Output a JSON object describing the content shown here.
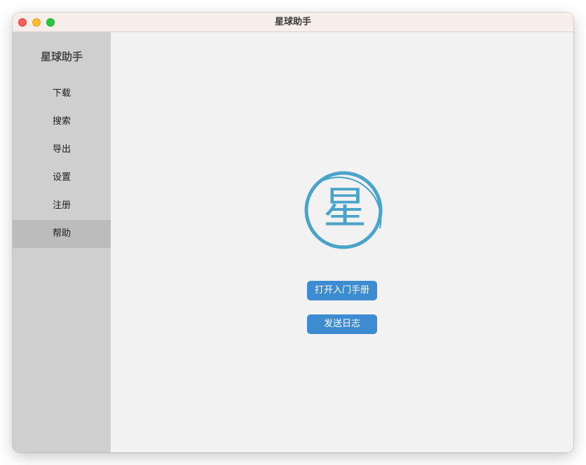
{
  "window": {
    "title": "星球助手"
  },
  "sidebar": {
    "title": "星球助手",
    "items": [
      {
        "label": "下载",
        "active": false
      },
      {
        "label": "搜索",
        "active": false
      },
      {
        "label": "导出",
        "active": false
      },
      {
        "label": "设置",
        "active": false
      },
      {
        "label": "注册",
        "active": false
      },
      {
        "label": "帮助",
        "active": true
      }
    ]
  },
  "main": {
    "logo": {
      "glyph": "星",
      "icon": "planet-logo-icon",
      "color": "#4aa3c8"
    },
    "buttons": {
      "open_manual": "打开入门手册",
      "send_log": "发送日志"
    }
  },
  "colors": {
    "accent": "#3d8bd0",
    "sidebar_bg": "#cfcfcf",
    "sidebar_active": "#bcbcbc"
  }
}
